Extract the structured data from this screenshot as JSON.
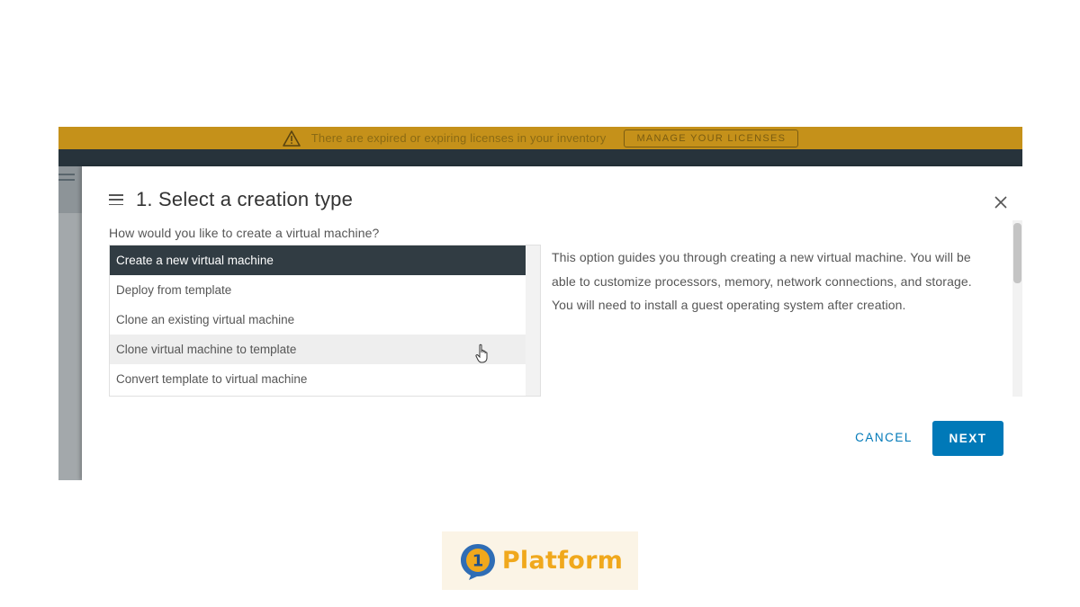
{
  "banner": {
    "message": "There are expired or expiring licenses in your inventory",
    "button_label": "MANAGE YOUR LICENSES",
    "background_color": "#c5911a"
  },
  "dialog": {
    "title": "1. Select a creation type",
    "question": "How would you like to create a virtual machine?",
    "options": [
      {
        "label": "Create a new virtual machine",
        "state": "selected"
      },
      {
        "label": "Deploy from template",
        "state": "normal"
      },
      {
        "label": "Clone an existing virtual machine",
        "state": "normal"
      },
      {
        "label": "Clone virtual machine to template",
        "state": "hover"
      },
      {
        "label": "Convert template to virtual machine",
        "state": "normal"
      }
    ],
    "description": "This option guides you through creating a new virtual machine. You will be able to customize processors, memory, network connections, and storage. You will need to install a guest operating system after creation.",
    "cancel_label": "CANCEL",
    "next_label": "NEXT",
    "accent_color": "#0079b8",
    "selected_color": "#313c43"
  },
  "icons": {
    "menu": "hamburger-icon",
    "close": "close-icon",
    "warning": "warning-triangle-icon",
    "cursor": "hand-pointer-icon"
  },
  "branding": {
    "logo_number": "1",
    "logo_text": "Platform",
    "logo_color": "#f0a81c"
  }
}
